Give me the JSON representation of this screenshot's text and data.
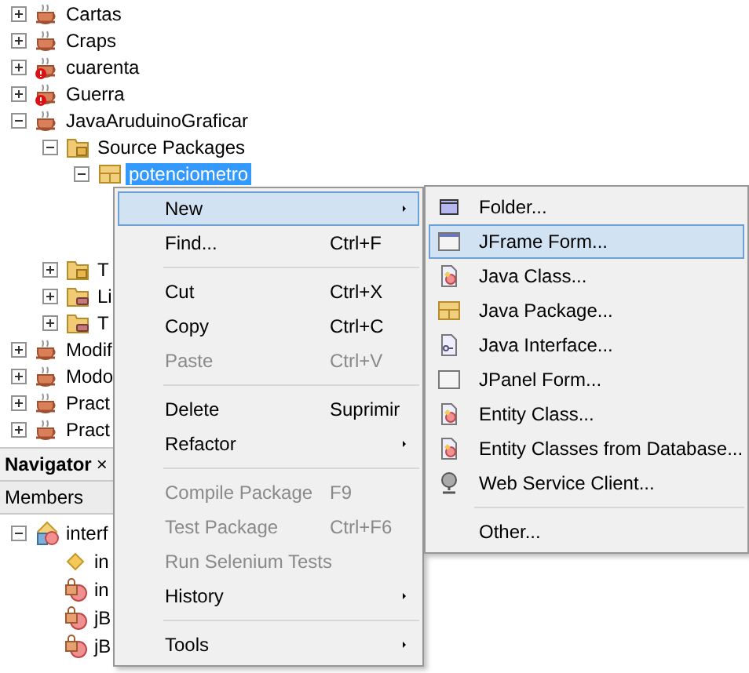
{
  "projects": [
    {
      "label": "Cartas",
      "expanded": false,
      "error": false,
      "kind": "project"
    },
    {
      "label": "Craps",
      "expanded": false,
      "error": false,
      "kind": "project"
    },
    {
      "label": "cuarenta",
      "expanded": false,
      "error": true,
      "kind": "project"
    },
    {
      "label": "Guerra",
      "expanded": false,
      "error": true,
      "kind": "project"
    },
    {
      "label": "JavaAruduinoGraficar",
      "expanded": true,
      "error": false,
      "kind": "project",
      "children": [
        {
          "label": "Source Packages",
          "expanded": true,
          "error": false,
          "kind": "source-folder",
          "children": [
            {
              "label": "potenciometro",
              "expanded": true,
              "error": false,
              "kind": "package",
              "selected": true
            }
          ]
        },
        {
          "label": "T",
          "expanded": false,
          "error": false,
          "kind": "source-folder"
        },
        {
          "label": "Li",
          "expanded": false,
          "error": false,
          "kind": "lib-folder"
        },
        {
          "label": "T",
          "expanded": false,
          "error": false,
          "kind": "lib-folder"
        }
      ]
    },
    {
      "label": "Modif",
      "expanded": false,
      "error": false,
      "kind": "project"
    },
    {
      "label": "Modo",
      "expanded": false,
      "error": false,
      "kind": "project"
    },
    {
      "label": "Pract",
      "expanded": false,
      "error": false,
      "kind": "project"
    },
    {
      "label": "Pract",
      "expanded": false,
      "error": false,
      "kind": "project"
    }
  ],
  "navigator": {
    "title": "Navigator",
    "close": "×",
    "header": "Members",
    "tree": [
      {
        "label": "interf",
        "expanded": true,
        "kind": "class",
        "children": [
          {
            "label": "in",
            "kind": "field"
          },
          {
            "label": "in",
            "kind": "locked-field"
          },
          {
            "label": "jB",
            "kind": "locked-field"
          },
          {
            "label": "jB",
            "kind": "locked-field"
          }
        ]
      }
    ]
  },
  "context_menu": [
    {
      "kind": "item",
      "label": "New",
      "submenu": true,
      "selected": true,
      "disabled": false
    },
    {
      "kind": "item",
      "label": "Find...",
      "shortcut": "Ctrl+F",
      "selected": false,
      "disabled": false
    },
    {
      "kind": "separator"
    },
    {
      "kind": "item",
      "label": "Cut",
      "shortcut": "Ctrl+X",
      "selected": false,
      "disabled": false
    },
    {
      "kind": "item",
      "label": "Copy",
      "shortcut": "Ctrl+C",
      "selected": false,
      "disabled": false
    },
    {
      "kind": "item",
      "label": "Paste",
      "shortcut": "Ctrl+V",
      "selected": false,
      "disabled": true
    },
    {
      "kind": "separator"
    },
    {
      "kind": "item",
      "label": "Delete",
      "shortcut": "Suprimir",
      "selected": false,
      "disabled": false
    },
    {
      "kind": "item",
      "label": "Refactor",
      "submenu": true,
      "selected": false,
      "disabled": false
    },
    {
      "kind": "separator"
    },
    {
      "kind": "item",
      "label": "Compile Package",
      "shortcut": "F9",
      "selected": false,
      "disabled": true
    },
    {
      "kind": "item",
      "label": "Test Package",
      "shortcut": "Ctrl+F6",
      "selected": false,
      "disabled": true
    },
    {
      "kind": "item",
      "label": "Run Selenium Tests",
      "selected": false,
      "disabled": true
    },
    {
      "kind": "item",
      "label": "History",
      "submenu": true,
      "selected": false,
      "disabled": false
    },
    {
      "kind": "separator"
    },
    {
      "kind": "item",
      "label": "Tools",
      "submenu": true,
      "selected": false,
      "disabled": false
    }
  ],
  "new_submenu": [
    {
      "kind": "folder",
      "label": "Folder...",
      "selected": false
    },
    {
      "kind": "frame",
      "label": "JFrame Form...",
      "selected": true
    },
    {
      "kind": "class",
      "label": "Java Class...",
      "selected": false
    },
    {
      "kind": "package",
      "label": "Java Package...",
      "selected": false
    },
    {
      "kind": "interface",
      "label": "Java Interface...",
      "selected": false
    },
    {
      "kind": "panel",
      "label": "JPanel Form...",
      "selected": false
    },
    {
      "kind": "class",
      "label": "Entity Class...",
      "selected": false
    },
    {
      "kind": "class",
      "label": "Entity Classes from Database...",
      "selected": false
    },
    {
      "kind": "globe",
      "label": "Web Service Client...",
      "selected": false
    },
    {
      "kind": "separator"
    },
    {
      "kind": "plain",
      "label": "Other...",
      "selected": false
    }
  ]
}
